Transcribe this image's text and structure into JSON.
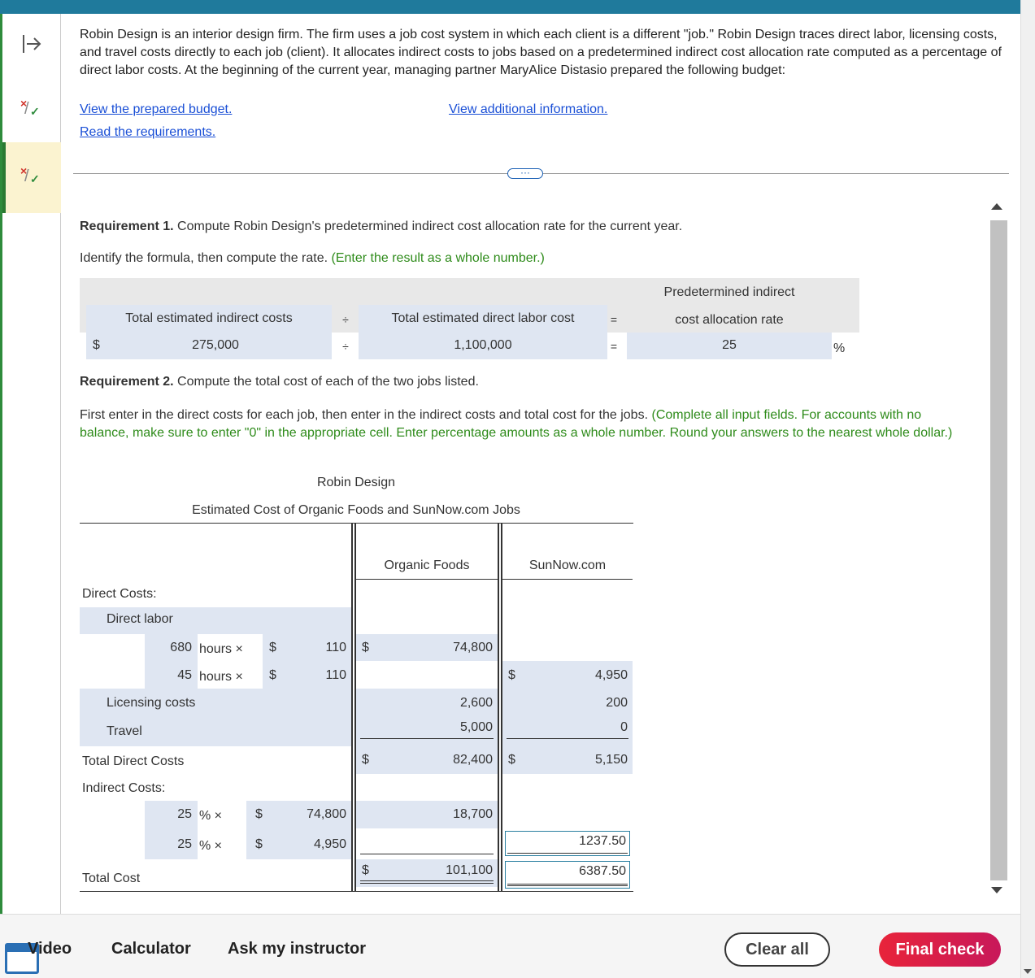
{
  "intro": {
    "text": "Robin Design is an interior design firm. The firm uses a job cost system in which each client is a different \"job.\" Robin Design traces direct labor, licensing costs, and travel costs directly to each job (client). It allocates indirect costs to jobs based on a predetermined indirect cost allocation rate computed as a percentage of direct labor costs. At the beginning of the current year, managing partner MaryAlice Distasio prepared the following budget:",
    "link_budget": "View the prepared budget.",
    "link_additional": "View additional information.",
    "link_requirements": "Read the requirements.",
    "expand_dots": "···"
  },
  "req1": {
    "title_bold": "Requirement 1.",
    "title_rest": " Compute Robin Design's predetermined indirect cost allocation rate for the current year.",
    "instruction": "Identify the formula, then compute the rate.",
    "instruction_green": "(Enter the result as a whole number.)",
    "header_left": "Total estimated indirect costs",
    "div_sign": "÷",
    "header_mid": "Total estimated direct labor cost",
    "eq_sign": "=",
    "header_right_1": "Predetermined indirect",
    "header_right_2": "cost allocation rate",
    "dollar": "$",
    "val_left": "275,000",
    "val_mid": "1,100,000",
    "val_right": "25",
    "pct": "%"
  },
  "req2": {
    "title_bold": "Requirement 2.",
    "title_rest": " Compute the total cost of each of the two jobs listed.",
    "instruction": "First enter in the direct costs for each job, then enter in the indirect costs and total cost for the jobs.",
    "instruction_green": "(Complete all input fields. For accounts with no balance, make sure to enter \"0\" in the appropriate cell. Enter percentage amounts as a whole number. Round your answers to the nearest whole dollar.)"
  },
  "table": {
    "company": "Robin Design",
    "subtitle": "Estimated Cost of Organic Foods and SunNow.com Jobs",
    "col1": "Organic Foods",
    "col2": "SunNow.com",
    "direct_costs": "Direct Costs:",
    "direct_labor": "Direct labor",
    "row1": {
      "hours": "680",
      "hours_label": "hours ×",
      "dollar": "$",
      "rate": "110",
      "of_dollar": "$",
      "organic": "74,800"
    },
    "row2": {
      "hours": "45",
      "hours_label": "hours ×",
      "dollar": "$",
      "rate": "110",
      "sn_dollar": "$",
      "sunnow": "4,950"
    },
    "licensing": {
      "label": "Licensing costs",
      "organic": "2,600",
      "sunnow": "200"
    },
    "travel": {
      "label": "Travel",
      "organic": "5,000",
      "sunnow": "0"
    },
    "total_direct": {
      "label": "Total Direct Costs",
      "of_dollar": "$",
      "organic": "82,400",
      "sn_dollar": "$",
      "sunnow": "5,150"
    },
    "indirect_costs": "Indirect Costs:",
    "ind1": {
      "pct": "25",
      "pct_label": "% ×",
      "dollar": "$",
      "base": "74,800",
      "organic": "18,700"
    },
    "ind2": {
      "pct": "25",
      "pct_label": "% ×",
      "dollar": "$",
      "base": "4,950",
      "sunnow": "1237.50"
    },
    "total_cost": {
      "label": "Total Cost",
      "of_dollar": "$",
      "organic": "101,100",
      "sunnow": "6387.50"
    }
  },
  "footer": {
    "video": "Video",
    "calculator": "Calculator",
    "ask": "Ask my instructor",
    "clear_all": "Clear all",
    "final_check": "Final check"
  },
  "colors": {
    "accent": "#1f7a9c",
    "green": "#2e8b1a",
    "final": "#e8243a",
    "shade": "#dfe6f2"
  }
}
